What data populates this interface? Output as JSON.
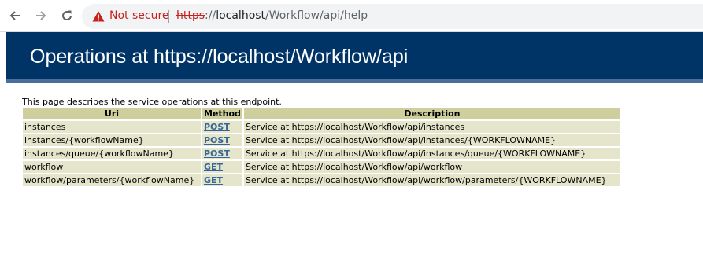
{
  "browser": {
    "security_label": "Not secure",
    "url_scheme": "https",
    "url_rest_prefix": "://",
    "url_host": "localhost",
    "url_path": "/Workflow/api/help",
    "colors": {
      "warning": "#c5221f",
      "toolbar": "#f1f3f4"
    },
    "icons": [
      "back-arrow-icon",
      "forward-arrow-icon",
      "reload-icon",
      "warning-icon"
    ]
  },
  "page": {
    "heading": "Operations at https://localhost/Workflow/api",
    "intro": "This page describes the service operations at this endpoint.",
    "colors": {
      "header_bg": "#003366",
      "table_header_bg": "#cecf9c",
      "table_row_bg": "#e5e5cc",
      "link": "#336699"
    },
    "table": {
      "headers": [
        "Uri",
        "Method",
        "Description"
      ],
      "rows": [
        {
          "uri": "instances",
          "method": "POST",
          "description": "Service at https://localhost/Workflow/api/instances"
        },
        {
          "uri": "instances/{workflowName}",
          "method": "POST",
          "description": "Service at https://localhost/Workflow/api/instances/{WORKFLOWNAME}"
        },
        {
          "uri": "instances/queue/{workflowName}",
          "method": "POST",
          "description": "Service at https://localhost/Workflow/api/instances/queue/{WORKFLOWNAME}"
        },
        {
          "uri": "workflow",
          "method": "GET",
          "description": "Service at https://localhost/Workflow/api/workflow"
        },
        {
          "uri": "workflow/parameters/{workflowName}",
          "method": "GET",
          "description": "Service at https://localhost/Workflow/api/workflow/parameters/{WORKFLOWNAME}"
        }
      ]
    }
  }
}
